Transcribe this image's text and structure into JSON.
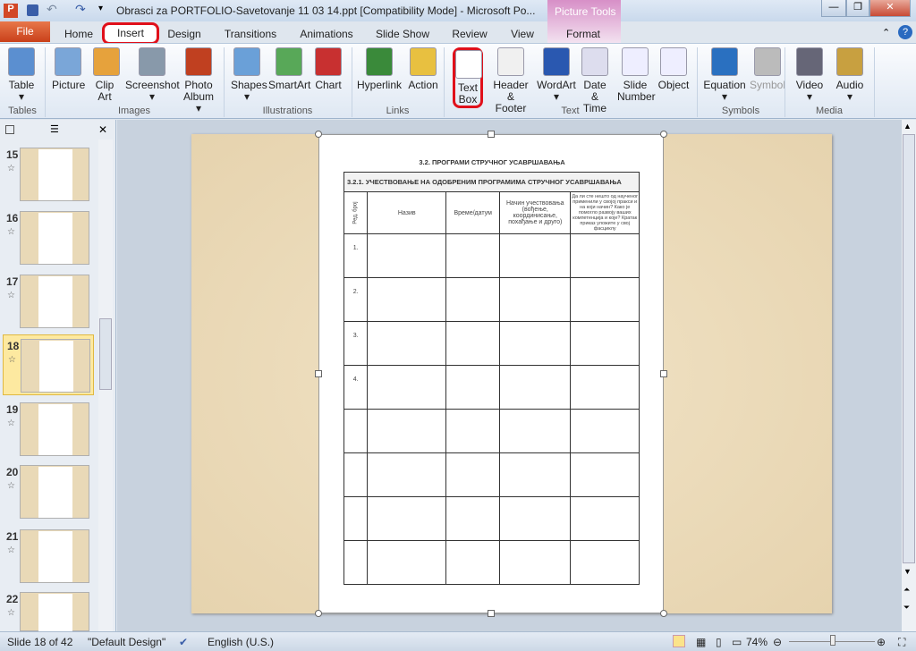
{
  "window": {
    "title": "Obrasci za PORTFOLIO-Savetovanje 11 03 14.ppt [Compatibility Mode]  -  Microsoft Po...",
    "context_tab_group": "Picture Tools"
  },
  "tabs": [
    "File",
    "Home",
    "Insert",
    "Design",
    "Transitions",
    "Animations",
    "Slide Show",
    "Review",
    "View",
    "Format"
  ],
  "ribbon": {
    "buttons": [
      {
        "label": "Table",
        "sub": "▾",
        "group": "Tables"
      },
      {
        "label": "Picture",
        "sub": "",
        "group": "Images"
      },
      {
        "label": "Clip",
        "sub": "Art",
        "group": "Images"
      },
      {
        "label": "Screenshot",
        "sub": "▾",
        "group": "Images"
      },
      {
        "label": "Photo",
        "sub": "Album ▾",
        "group": "Images"
      },
      {
        "label": "Shapes",
        "sub": "▾",
        "group": "Illustrations"
      },
      {
        "label": "SmartArt",
        "sub": "",
        "group": "Illustrations"
      },
      {
        "label": "Chart",
        "sub": "",
        "group": "Illustrations"
      },
      {
        "label": "Hyperlink",
        "sub": "",
        "group": "Links"
      },
      {
        "label": "Action",
        "sub": "",
        "group": "Links"
      },
      {
        "label": "Text",
        "sub": "Box",
        "group": "Text"
      },
      {
        "label": "Header",
        "sub": "& Footer",
        "group": "Text"
      },
      {
        "label": "WordArt",
        "sub": "▾",
        "group": "Text"
      },
      {
        "label": "Date",
        "sub": "& Time",
        "group": "Text"
      },
      {
        "label": "Slide",
        "sub": "Number",
        "group": "Text"
      },
      {
        "label": "Object",
        "sub": "",
        "group": "Text"
      },
      {
        "label": "Equation",
        "sub": "▾",
        "group": "Symbols"
      },
      {
        "label": "Symbol",
        "sub": "",
        "group": "Symbols"
      },
      {
        "label": "Video",
        "sub": "▾",
        "group": "Media"
      },
      {
        "label": "Audio",
        "sub": "▾",
        "group": "Media"
      }
    ],
    "groups": [
      "Tables",
      "Images",
      "Illustrations",
      "Links",
      "Text",
      "Symbols",
      "Media"
    ]
  },
  "thumbnails": [
    "15",
    "16",
    "17",
    "18",
    "19",
    "20",
    "21",
    "22"
  ],
  "selected_slide": "18",
  "slide": {
    "heading": "3.2. ПРОГРАМИ СТРУЧНОГ УСАВРШАВАЊА",
    "table_title": "3.2.1. УЧЕСТВОВАЊЕ НА ОДОБРЕНИМ ПРОГРАМИМА СТРУЧНОГ УСАВРШАВАЊА",
    "columns": [
      "Ред. број",
      "Назив",
      "Време/датум",
      "Начин учествовања (вођење, координисање, похађање и друго)",
      "Да ли сте нешто од наученог применили у својој пракси и на који начин? Како је помогло развоју ваших компетенција и које? Кратак приказ уложите у свој фасциклу"
    ],
    "rows": [
      "1.",
      "2.",
      "3.",
      "4.",
      "",
      "",
      "",
      ""
    ]
  },
  "status": {
    "slide": "Slide 18 of 42",
    "theme": "\"Default Design\"",
    "language": "English (U.S.)",
    "zoom": "74%",
    "zoom_percent": 74
  }
}
